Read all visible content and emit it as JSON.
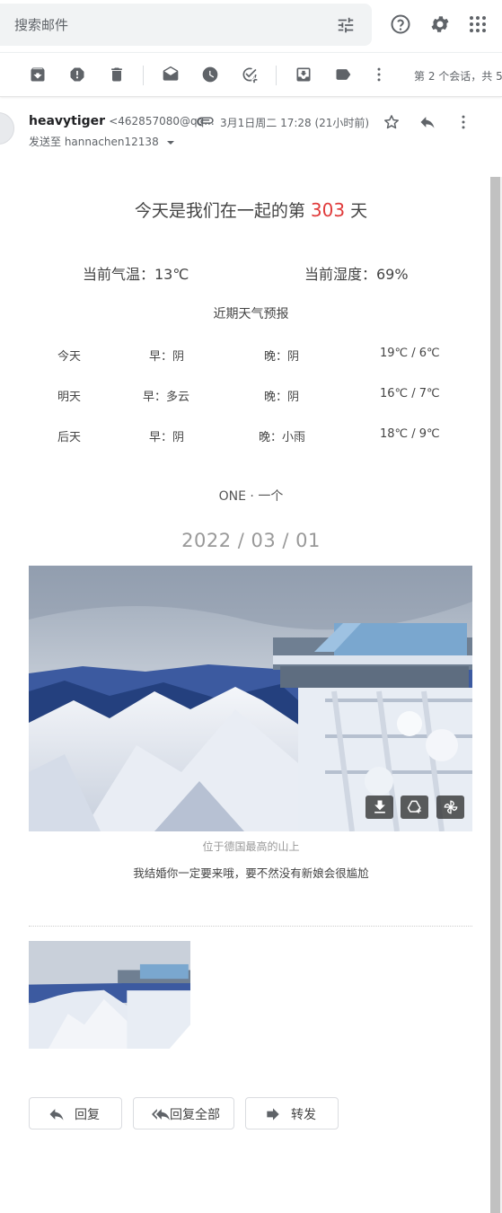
{
  "search": {
    "placeholder": "搜索邮件"
  },
  "icons": {
    "tune": "tune-icon",
    "help": "help-icon",
    "settings": "gear-icon",
    "apps": "apps-grid-icon",
    "archive": "archive-icon",
    "spam": "report-spam-icon",
    "delete": "trash-icon",
    "mark_unread": "mark-unread-icon",
    "snooze": "snooze-icon",
    "add_task": "add-task-icon",
    "move": "move-to-icon",
    "label": "label-icon",
    "more": "more-vert-icon",
    "star": "star-icon",
    "reply": "reply-icon",
    "attachment": "paperclip-icon",
    "download": "download-icon",
    "drive": "add-to-drive-icon",
    "photos": "google-photos-icon"
  },
  "toolbar": {
    "count_text": "第 2 个会话，共 5"
  },
  "email": {
    "sender_name": "heavytiger",
    "sender_addr": "<462857080@qq...",
    "date": "3月1日周二 17:28 (21小时前)",
    "to_text": "发送至 hannachen12138"
  },
  "body": {
    "days_prefix": "今天是我们在一起的第 ",
    "days_count": "303",
    "days_suffix": " 天",
    "temp": "当前气温：13℃",
    "humidity": "当前湿度：69%",
    "forecast_title": "近期天气预报",
    "forecast": [
      {
        "day": "今天",
        "morning": "早：阴",
        "evening": "晚：阴",
        "range": "19℃ / 6℃"
      },
      {
        "day": "明天",
        "morning": "早：多云",
        "evening": "晚：阴",
        "range": "16℃ / 7℃"
      },
      {
        "day": "后天",
        "morning": "早：阴",
        "evening": "晚：小雨",
        "range": "18℃ / 9℃"
      }
    ],
    "one_title": "ONE · 一个",
    "date": "2022 / 03 / 01",
    "caption": "位于德国最高的山上",
    "quote": "我结婚你一定要来哦，要不然没有新娘会很尴尬"
  },
  "actions": {
    "reply": "回复",
    "reply_all": "回复全部",
    "forward": "转发"
  },
  "colors": {
    "accent_red": "#e03b3b",
    "search_bg": "#f1f3f4",
    "icon_grey": "#5f6368"
  }
}
